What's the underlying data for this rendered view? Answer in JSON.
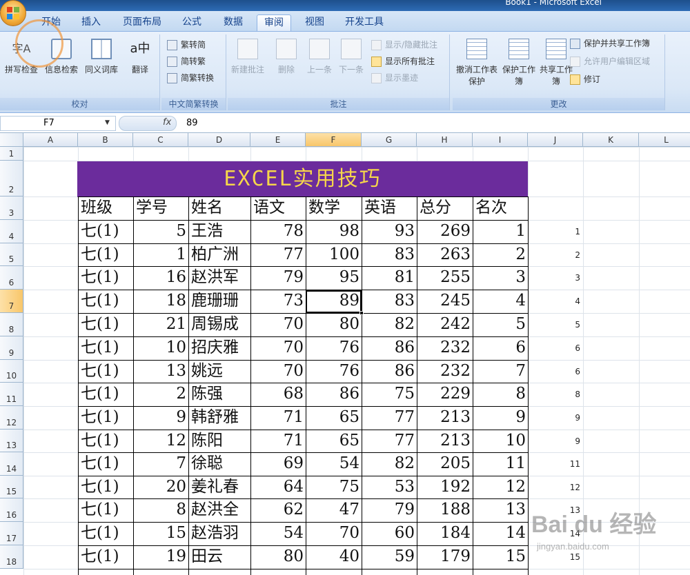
{
  "window": {
    "title": "Book1 - Microsoft Excel"
  },
  "tabs": [
    "开始",
    "插入",
    "页面布局",
    "公式",
    "数据",
    "审阅",
    "视图",
    "开发工具"
  ],
  "active_tab": "审阅",
  "ribbon": {
    "proofing": {
      "label": "校对",
      "buttons": [
        "拼写检查",
        "信息检索",
        "同义词库",
        "翻译"
      ],
      "trans_glyph": "a中",
      "spell_glyph": "字A"
    },
    "chinese": {
      "label": "中文简繁转换",
      "buttons": [
        "繁转简",
        "简转繁",
        "简繁转换"
      ]
    },
    "comments": {
      "label": "批注",
      "buttons": [
        "新建批注",
        "删除",
        "上一条",
        "下一条"
      ],
      "small": [
        "显示/隐藏批注",
        "显示所有批注",
        "显示墨迹"
      ]
    },
    "changes": {
      "label": "更改",
      "buttons": [
        "撤消工作表保护",
        "保护工作簿",
        "共享工作簿"
      ],
      "small": [
        "保护并共享工作簿",
        "允许用户编辑区域",
        "修订"
      ]
    }
  },
  "formula_bar": {
    "name_box": "F7",
    "fx": "fx",
    "value": "89"
  },
  "columns": [
    "A",
    "B",
    "C",
    "D",
    "E",
    "F",
    "G",
    "H",
    "I",
    "J",
    "K",
    "L"
  ],
  "selected_column": "F",
  "rows": [
    "1",
    "2",
    "3",
    "4",
    "5",
    "6",
    "7",
    "8",
    "9",
    "10",
    "11",
    "12",
    "13",
    "14",
    "15",
    "16",
    "17",
    "18"
  ],
  "selected_row": "7",
  "banner": "EXCEL实用技巧",
  "table": {
    "headers": [
      "班级",
      "学号",
      "姓名",
      "语文",
      "数学",
      "英语",
      "总分",
      "名次"
    ],
    "rows": [
      [
        "七(1)",
        "5",
        "王浩",
        "78",
        "98",
        "93",
        "269",
        "1"
      ],
      [
        "七(1)",
        "1",
        "柏广洲",
        "77",
        "100",
        "83",
        "263",
        "2"
      ],
      [
        "七(1)",
        "16",
        "赵洪军",
        "79",
        "95",
        "81",
        "255",
        "3"
      ],
      [
        "七(1)",
        "18",
        "鹿珊珊",
        "73",
        "89",
        "83",
        "245",
        "4"
      ],
      [
        "七(1)",
        "21",
        "周锡成",
        "70",
        "80",
        "82",
        "242",
        "5"
      ],
      [
        "七(1)",
        "10",
        "招庆雅",
        "70",
        "76",
        "86",
        "232",
        "6"
      ],
      [
        "七(1)",
        "13",
        "姚远",
        "70",
        "76",
        "86",
        "232",
        "7"
      ],
      [
        "七(1)",
        "2",
        "陈强",
        "68",
        "86",
        "75",
        "229",
        "8"
      ],
      [
        "七(1)",
        "9",
        "韩舒雅",
        "71",
        "65",
        "77",
        "213",
        "9"
      ],
      [
        "七(1)",
        "12",
        "陈阳",
        "71",
        "65",
        "77",
        "213",
        "10"
      ],
      [
        "七(1)",
        "7",
        "徐聪",
        "69",
        "54",
        "82",
        "205",
        "11"
      ],
      [
        "七(1)",
        "20",
        "姜礼春",
        "64",
        "75",
        "53",
        "192",
        "12"
      ],
      [
        "七(1)",
        "8",
        "赵洪全",
        "62",
        "47",
        "79",
        "188",
        "13"
      ],
      [
        "七(1)",
        "15",
        "赵浩羽",
        "54",
        "70",
        "60",
        "184",
        "14"
      ],
      [
        "七(1)",
        "19",
        "田云",
        "80",
        "40",
        "59",
        "179",
        "15"
      ]
    ]
  },
  "column_j": [
    "1",
    "2",
    "3",
    "4",
    "5",
    "6",
    "6",
    "8",
    "9",
    "9",
    "11",
    "12",
    "13",
    "14",
    "15"
  ],
  "watermark": {
    "logo": "Bai du 经验",
    "url": "jingyan.baidu.com"
  }
}
